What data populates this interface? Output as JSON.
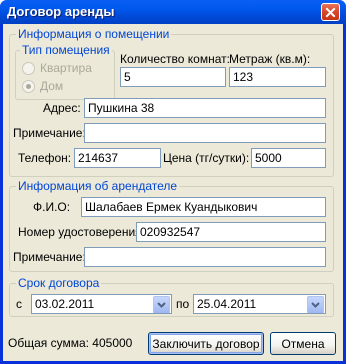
{
  "window": {
    "title": "Договор аренды"
  },
  "room_group": {
    "title": "Информация о помещении",
    "room_type": {
      "title": "Тип помещения",
      "options": [
        "Квартира",
        "Дом"
      ],
      "selected": "Дом"
    },
    "rooms_label": "Количество комнат:",
    "rooms_value": "5",
    "area_label": "Метраж (кв.м):",
    "area_value": "123",
    "address_label": "Адрес:",
    "address_value": "Пушкина 38",
    "note_label": "Примечание:",
    "note_value": "",
    "phone_label": "Телефон:",
    "phone_value": "214637",
    "price_label": "Цена (тг/сутки):",
    "price_value": "5000"
  },
  "tenant_group": {
    "title": "Информация об арендателе",
    "name_label": "Ф.И.О:",
    "name_value": "Шалабаев Ермек Куандыкович",
    "id_label": "Номер удостоверения:",
    "id_value": "020932547",
    "note_label": "Примечание:",
    "note_value": ""
  },
  "term_group": {
    "title": "Срок договора",
    "from_label": "с",
    "from_value": "03.02.2011",
    "to_label": "по",
    "to_value": "25.04.2011"
  },
  "total_label": "Общая сумма: 405000",
  "buttons": {
    "confirm": "Заключить договор",
    "cancel": "Отмена"
  },
  "colors": {
    "titlebar": "#0054e3",
    "group_title": "#0046d5",
    "client_bg": "#ece9d8"
  }
}
